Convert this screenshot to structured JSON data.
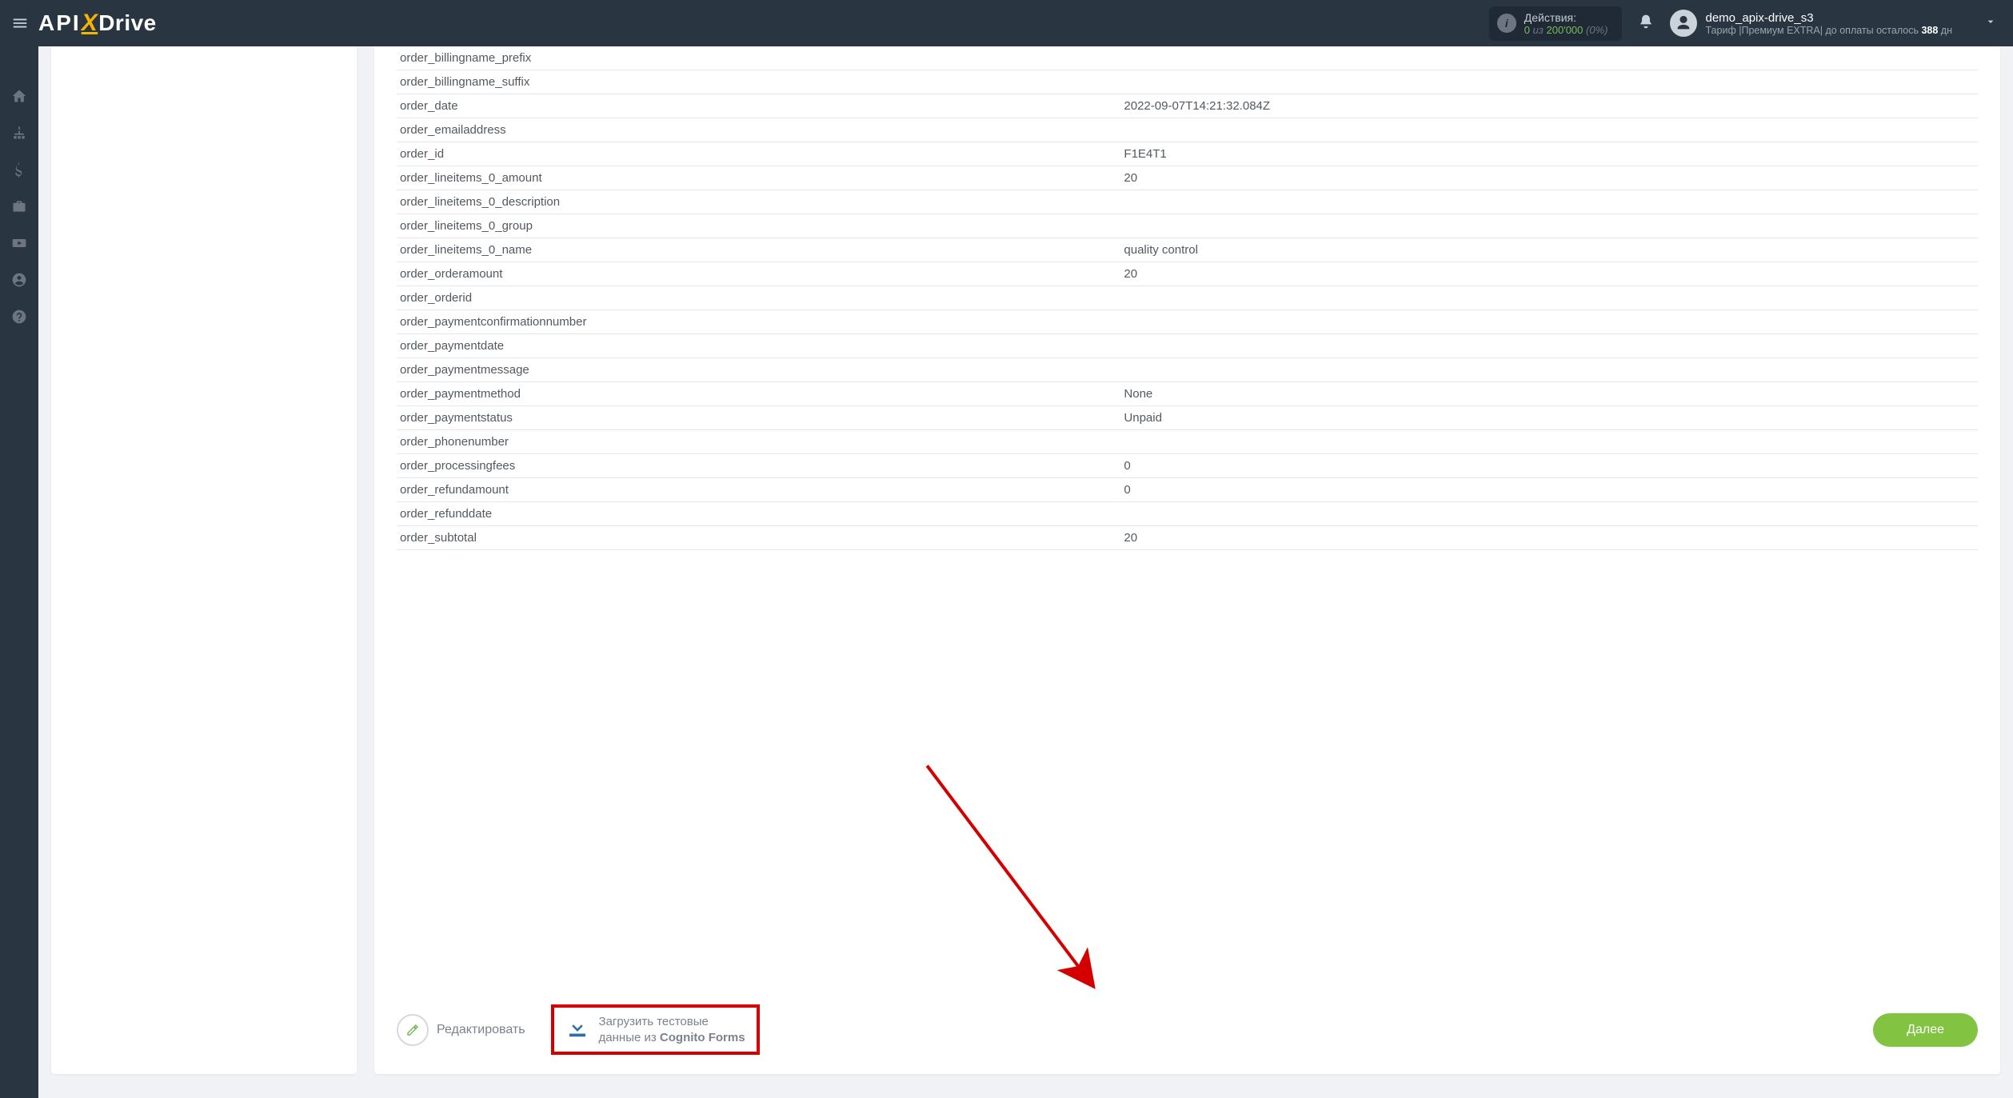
{
  "header": {
    "actions_label": "Действия:",
    "actions_used": "0",
    "actions_of": "из",
    "actions_limit": "200'000",
    "actions_pct": "(0%)",
    "user_name": "demo_apix-drive_s3",
    "plan_prefix": "Тариф |",
    "plan_name": "Премиум EXTRA",
    "plan_mid": "| до оплаты осталось ",
    "plan_days": "388",
    "plan_suffix": " дн"
  },
  "rows": [
    {
      "key": "order_billingname_prefix",
      "val": ""
    },
    {
      "key": "order_billingname_suffix",
      "val": ""
    },
    {
      "key": "order_date",
      "val": "2022-09-07T14:21:32.084Z"
    },
    {
      "key": "order_emailaddress",
      "val": ""
    },
    {
      "key": "order_id",
      "val": "F1E4T1"
    },
    {
      "key": "order_lineitems_0_amount",
      "val": "20"
    },
    {
      "key": "order_lineitems_0_description",
      "val": ""
    },
    {
      "key": "order_lineitems_0_group",
      "val": ""
    },
    {
      "key": "order_lineitems_0_name",
      "val": "quality control"
    },
    {
      "key": "order_orderamount",
      "val": "20"
    },
    {
      "key": "order_orderid",
      "val": ""
    },
    {
      "key": "order_paymentconfirmationnumber",
      "val": ""
    },
    {
      "key": "order_paymentdate",
      "val": ""
    },
    {
      "key": "order_paymentmessage",
      "val": ""
    },
    {
      "key": "order_paymentmethod",
      "val": "None"
    },
    {
      "key": "order_paymentstatus",
      "val": "Unpaid"
    },
    {
      "key": "order_phonenumber",
      "val": ""
    },
    {
      "key": "order_processingfees",
      "val": "0"
    },
    {
      "key": "order_refundamount",
      "val": "0"
    },
    {
      "key": "order_refunddate",
      "val": ""
    },
    {
      "key": "order_subtotal",
      "val": "20"
    }
  ],
  "footer": {
    "edit_label": "Редактировать",
    "load_line1": "Загрузить тестовые",
    "load_line2_prefix": "данные из ",
    "load_line2_strong": "Cognito Forms",
    "next_label": "Далее"
  }
}
